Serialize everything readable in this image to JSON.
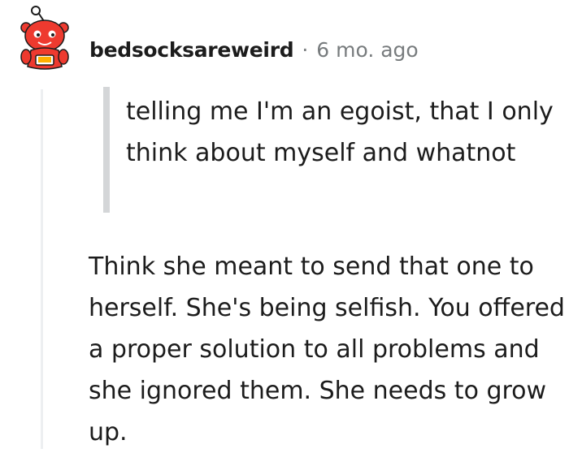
{
  "comment": {
    "author": "bedsocksareweird",
    "separator": "·",
    "timestamp": "6 mo. ago",
    "avatar": "reddit-snoo-avatar-icon",
    "quote": "telling me I'm an egoist, that I only think about myself and whatnot",
    "body": "Think she meant to send that one to herself. She's being selfish. You offered a proper solution to all problems and she ignored them. She needs to grow up."
  },
  "colors": {
    "avatar_red": "#ee3a2f",
    "meta_gray": "#787c7e",
    "quote_bar": "#d4d6d8",
    "thread_line": "#edeff1"
  }
}
